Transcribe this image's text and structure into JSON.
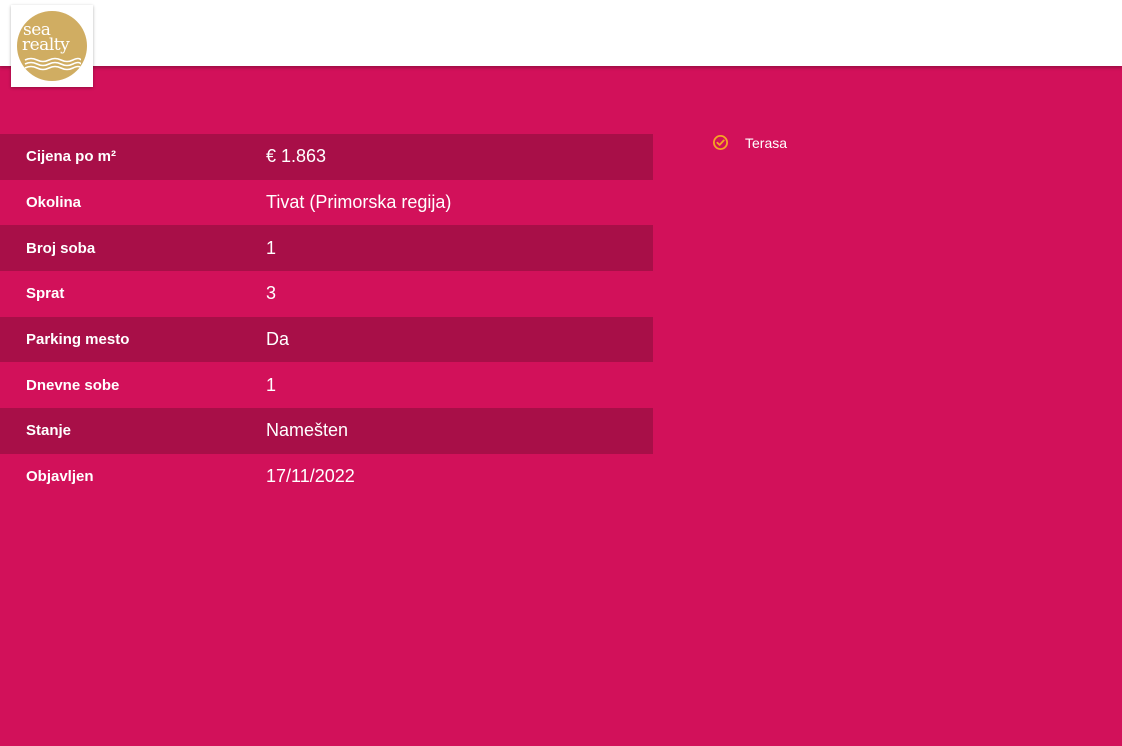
{
  "logo": {
    "line1": "sea",
    "line2": "realty",
    "color": "#d0ad62"
  },
  "colors": {
    "background": "#d2115a",
    "row_dark": "#a80f48",
    "accent": "#f5a623"
  },
  "details": [
    {
      "label": "Cijena po m²",
      "value": "€ 1.863"
    },
    {
      "label": "Okolina",
      "value": "Tivat (Primorska regija)"
    },
    {
      "label": "Broj soba",
      "value": "1"
    },
    {
      "label": "Sprat",
      "value": "3"
    },
    {
      "label": "Parking mesto",
      "value": "Da"
    },
    {
      "label": "Dnevne sobe",
      "value": "1"
    },
    {
      "label": "Stanje",
      "value": "Namešten"
    },
    {
      "label": "Objavljen",
      "value": "17/11/2022"
    }
  ],
  "features": [
    {
      "label": "Terasa",
      "icon": "check-circle-icon"
    }
  ]
}
